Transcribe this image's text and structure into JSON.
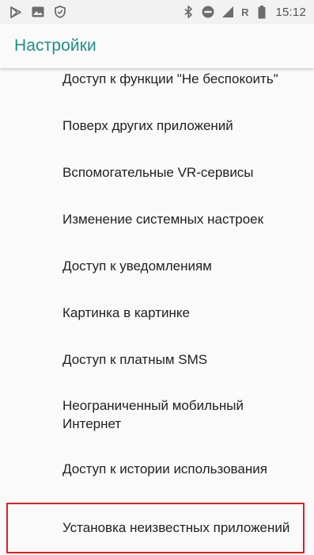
{
  "status_bar": {
    "left_icons": [
      "play-store-icon",
      "image-icon",
      "shield-icon"
    ],
    "right_icons": [
      "bluetooth-icon",
      "do-not-disturb-icon",
      "signal-icon",
      "roaming-indicator",
      "battery-icon"
    ],
    "roaming_label": "R",
    "time": "15:12"
  },
  "app_bar": {
    "title": "Настройки",
    "accent_color": "#1f8f86"
  },
  "list": {
    "items": [
      {
        "label": "Доступ к функции \"Не беспокоить\""
      },
      {
        "label": "Поверх других приложений"
      },
      {
        "label": "Вспомогательные VR-сервисы"
      },
      {
        "label": "Изменение системных настроек"
      },
      {
        "label": "Доступ к уведомлениям"
      },
      {
        "label": "Картинка в картинке"
      },
      {
        "label": "Доступ к платным SMS"
      },
      {
        "label": "Неограниченный мобильный Интернет"
      },
      {
        "label": "Доступ к истории использования"
      },
      {
        "label": "Установка неизвестных приложений",
        "highlighted": true
      }
    ],
    "highlight_color": "#e0201f"
  }
}
